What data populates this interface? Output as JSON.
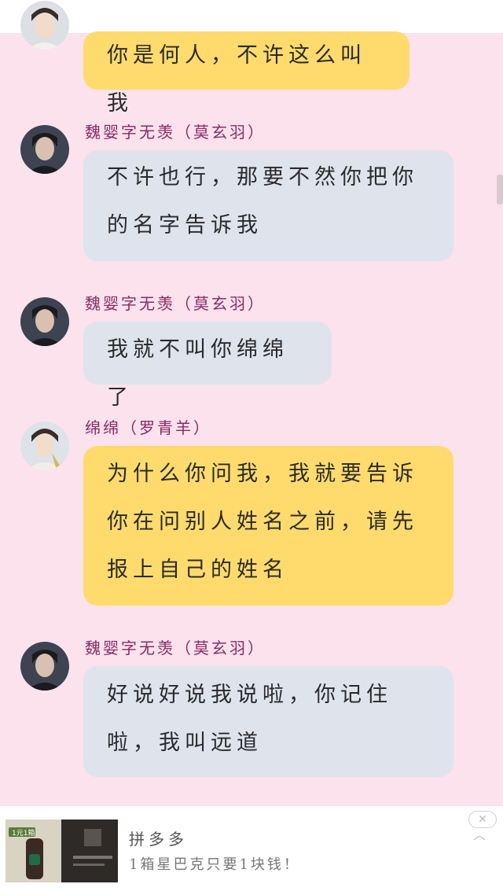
{
  "messages": [
    {
      "speaker": "",
      "text_lines": [
        "你是何人，不许这么叫我"
      ],
      "color": "yellow",
      "avatar": "female-avatar"
    },
    {
      "speaker": "魏婴字无羡（莫玄羽）",
      "text_lines": [
        "不许也行，那要不然你把你",
        "的名字告诉我"
      ],
      "color": "grey",
      "avatar": "male-avatar"
    },
    {
      "speaker": "魏婴字无羡（莫玄羽）",
      "text_lines": [
        "我就不叫你绵绵了"
      ],
      "color": "grey",
      "avatar": "male-avatar"
    },
    {
      "speaker": "绵绵（罗青羊）",
      "text_lines": [
        "为什么你问我，我就要告诉",
        "你在问别人姓名之前，请先",
        "报上自己的姓名"
      ],
      "color": "yellow",
      "avatar": "female-avatar"
    },
    {
      "speaker": "魏婴字无羡（莫玄羽）",
      "text_lines": [
        "好说好说我说啦，你记住",
        "啦，我叫远道"
      ],
      "color": "grey",
      "avatar": "male-avatar"
    }
  ],
  "ad": {
    "brand": "拼多多",
    "text": "1箱星巴克只要1块钱！",
    "close_icon": "close-icon",
    "collapse_icon": "chevron-up-icon",
    "thumb_badge": "1元1箱"
  },
  "colors": {
    "background": "#fbe2ec",
    "bubble_yellow": "#fedb6c",
    "bubble_grey": "#dfe3ec",
    "speaker_name": "#8a2a68"
  }
}
